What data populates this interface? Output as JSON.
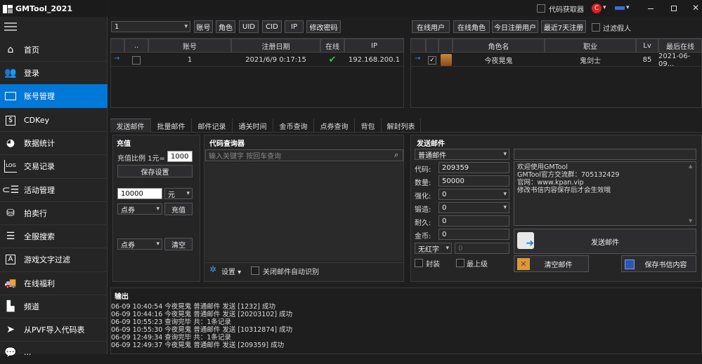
{
  "app": {
    "title": "GMTool_2021"
  },
  "nav": [
    "首页",
    "登录",
    "账号管理",
    "CDKey",
    "数据统计",
    "交易记录",
    "活动管理",
    "拍卖行",
    "全服搜索",
    "游戏文字过滤",
    "在线福利",
    "频道",
    "从PVF导入代码表",
    "..."
  ],
  "window": {
    "code_getter": "代码获取器"
  },
  "toolbar": {
    "server": "1",
    "account": "账号",
    "role": "角色",
    "uid": "UID",
    "cid": "CID",
    "ip": "IP",
    "change_pwd": "修改密码"
  },
  "toolbar_right": {
    "online_users": "在线用户",
    "online_roles": "在线角色",
    "today_reg": "今日注册用户",
    "last7": "最近7天注册",
    "filter_fake": "过滤假人"
  },
  "account_table": {
    "headers": [
      "..",
      "账号",
      "注册日期",
      "在线",
      "IP"
    ],
    "rows": [
      {
        "id": "1",
        "date": "2021/6/9 0:17:15",
        "ip": "192.168.200.1"
      }
    ]
  },
  "role_table": {
    "headers": [
      "角色名",
      "职业",
      "Lv",
      "最后在线"
    ],
    "rows": [
      {
        "name": "今夜晃鬼",
        "job": "鬼剑士",
        "lv": "85",
        "last": "2021-06-09..."
      }
    ]
  },
  "tabs": [
    "发送邮件",
    "批量邮件",
    "邮件记录",
    "通关时间",
    "金币查询",
    "点券查询",
    "背包",
    "解封列表"
  ],
  "recharge": {
    "title": "充值",
    "ratio_label": "充值比例 1元=",
    "ratio_value": "1000",
    "save": "保存设置",
    "amount": "10000",
    "unit": "元",
    "type": "点券",
    "recharge_btn": "充值",
    "type2": "点券",
    "clear": "清空"
  },
  "code_query": {
    "title": "代码查询器",
    "placeholder": "输入关键字 按回车查询",
    "settings": "设置",
    "auto_detect": "关闭邮件自动识别"
  },
  "mail": {
    "title": "发送邮件",
    "type": "普通邮件",
    "code_label": "代码:",
    "code": "209359",
    "qty_label": "数量:",
    "qty": "50000",
    "strengthen_label": "强化:",
    "strengthen": "0",
    "forge_label": "锻造:",
    "forge": "0",
    "dur_label": "耐久:",
    "dur": "0",
    "gold_label": "金币:",
    "gold": "0",
    "red": "无红字",
    "red_val": "0",
    "seal": "封装",
    "max_level": "最上级",
    "content": [
      "欢迎使用GMTool",
      "GMTool官方交流群：705132429",
      "官网：www.kpan.vip",
      "修改书信内容保存后才会生效哦"
    ],
    "send": "发送邮件",
    "clear": "清空邮件",
    "save": "保存书信内容"
  },
  "output": {
    "title": "输出",
    "lines": [
      "06-09 10:40:54 今夜晃鬼 普通邮件 发送 [1232] 成功",
      "06-09 10:44:16 今夜晃鬼 普通邮件 发送 [20203102] 成功",
      "06-09 10:55:23 查询完毕 共：1条记录",
      "06-09 10:55:30 今夜晃鬼 普通邮件 发送 [10312874] 成功",
      "06-09 12:49:34 查询完毕 共：1条记录",
      "06-09 12:49:37 今夜晃鬼 普通邮件 发送 [209359] 成功"
    ]
  }
}
